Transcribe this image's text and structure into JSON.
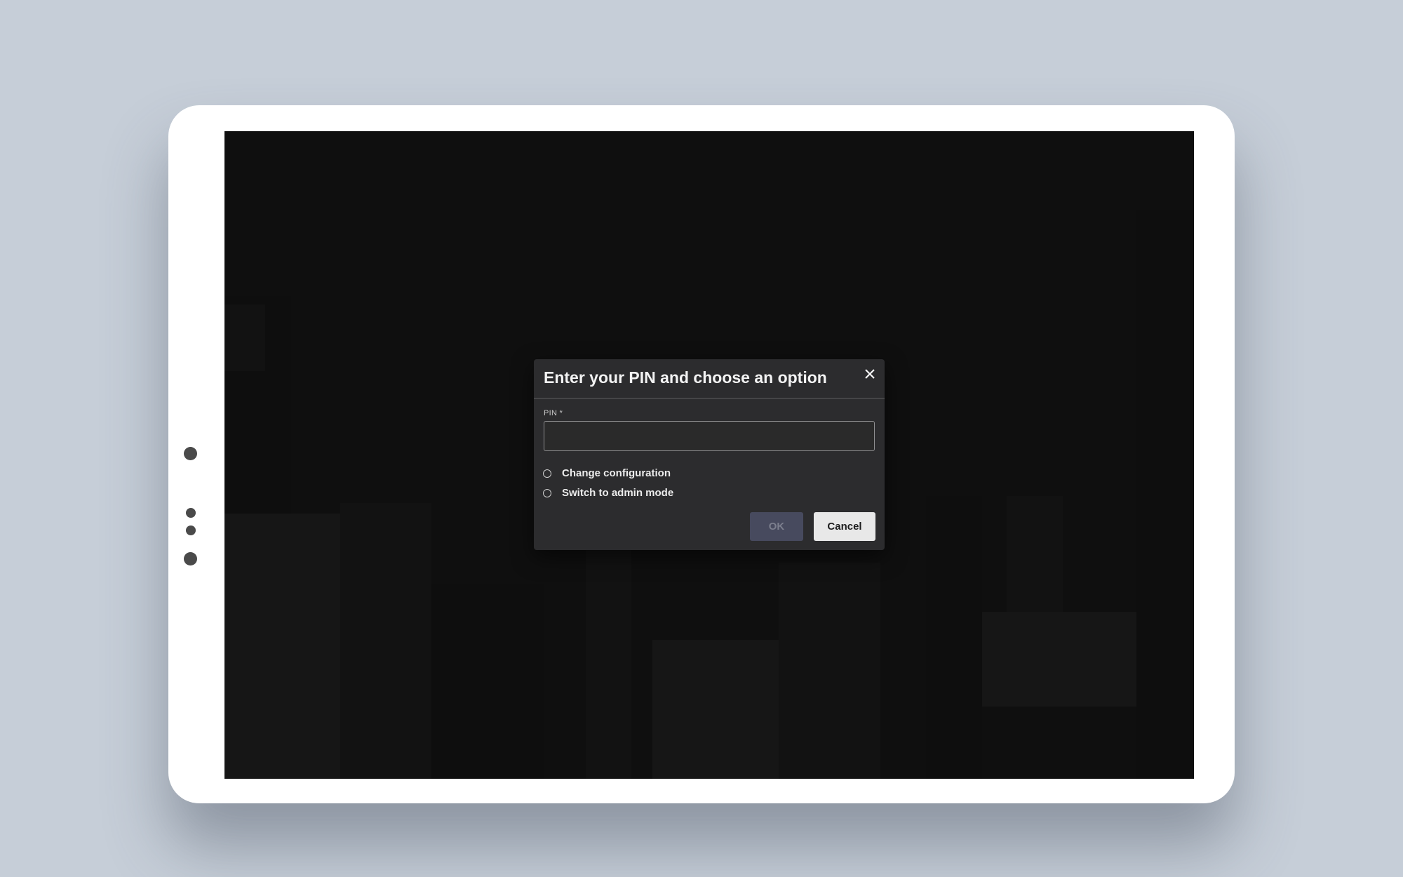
{
  "dialog": {
    "title": "Enter your PIN and choose an option",
    "close_icon": "close-icon",
    "pin_label": "PIN *",
    "pin_value": "",
    "options": [
      {
        "label": "Change configuration",
        "selected": false
      },
      {
        "label": "Switch to admin mode",
        "selected": false
      }
    ],
    "ok_label": "OK",
    "ok_disabled": true,
    "cancel_label": "Cancel"
  },
  "colors": {
    "page_background": "#c6ced8",
    "device_frame": "#ffffff",
    "screen_background": "#161616",
    "dialog_background": "#2c2c2e",
    "ok_button": "#474a5e",
    "cancel_button": "#e8e8e8"
  }
}
